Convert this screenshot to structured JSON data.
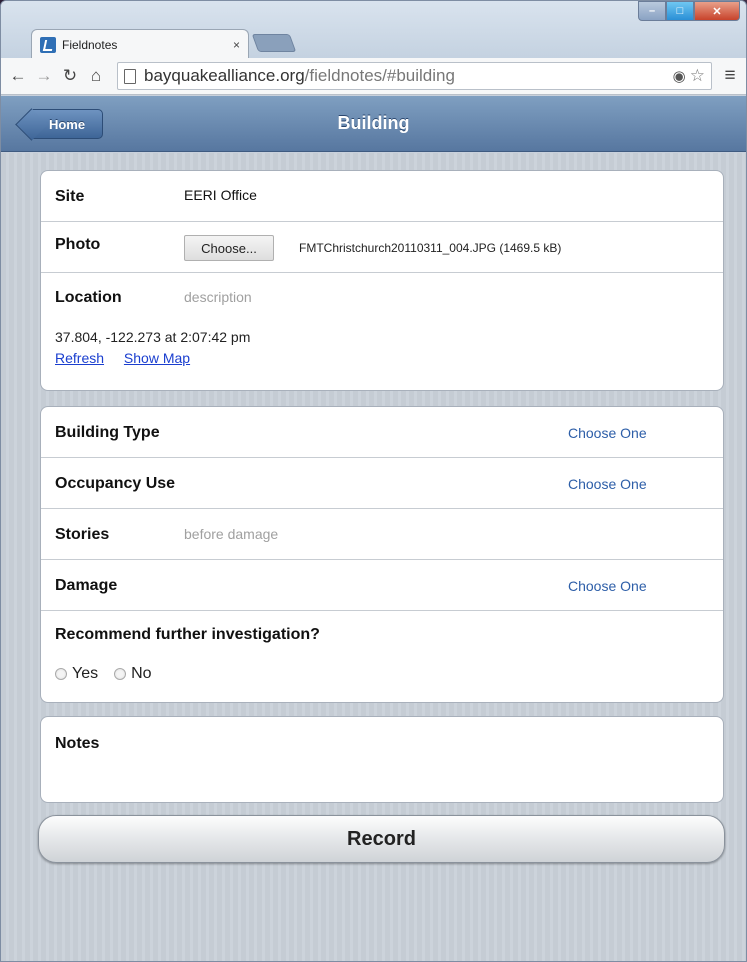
{
  "browser": {
    "tab_title": "Fieldnotes",
    "tab_close": "×",
    "url_host": "bayquakealliance.org",
    "url_path": "/fieldnotes/#building"
  },
  "header": {
    "back_label": "Home",
    "title": "Building"
  },
  "site_group": {
    "site_label": "Site",
    "site_value": "EERI Office",
    "photo_label": "Photo",
    "photo_button": "Choose...",
    "photo_file": "FMTChristchurch20110311_004.JPG (1469.5 kB)",
    "location_label": "Location",
    "location_placeholder": "description",
    "coords": "37.804, -122.273 at 2:07:42 pm",
    "refresh_link": "Refresh",
    "show_map_link": "Show Map"
  },
  "building_group": {
    "building_type_label": "Building Type",
    "building_type_value": "Choose One",
    "occupancy_label": "Occupancy Use",
    "occupancy_value": "Choose One",
    "stories_label": "Stories",
    "stories_placeholder": "before damage",
    "damage_label": "Damage",
    "damage_value": "Choose One",
    "recommend_label": "Recommend further investigation?",
    "yes_label": "Yes",
    "no_label": "No"
  },
  "notes_group": {
    "notes_label": "Notes"
  },
  "record_label": "Record",
  "colors": {
    "header_blue": "#5777a0",
    "link_blue": "#1a3ecf",
    "choose_one_blue": "#2d5ea8"
  }
}
